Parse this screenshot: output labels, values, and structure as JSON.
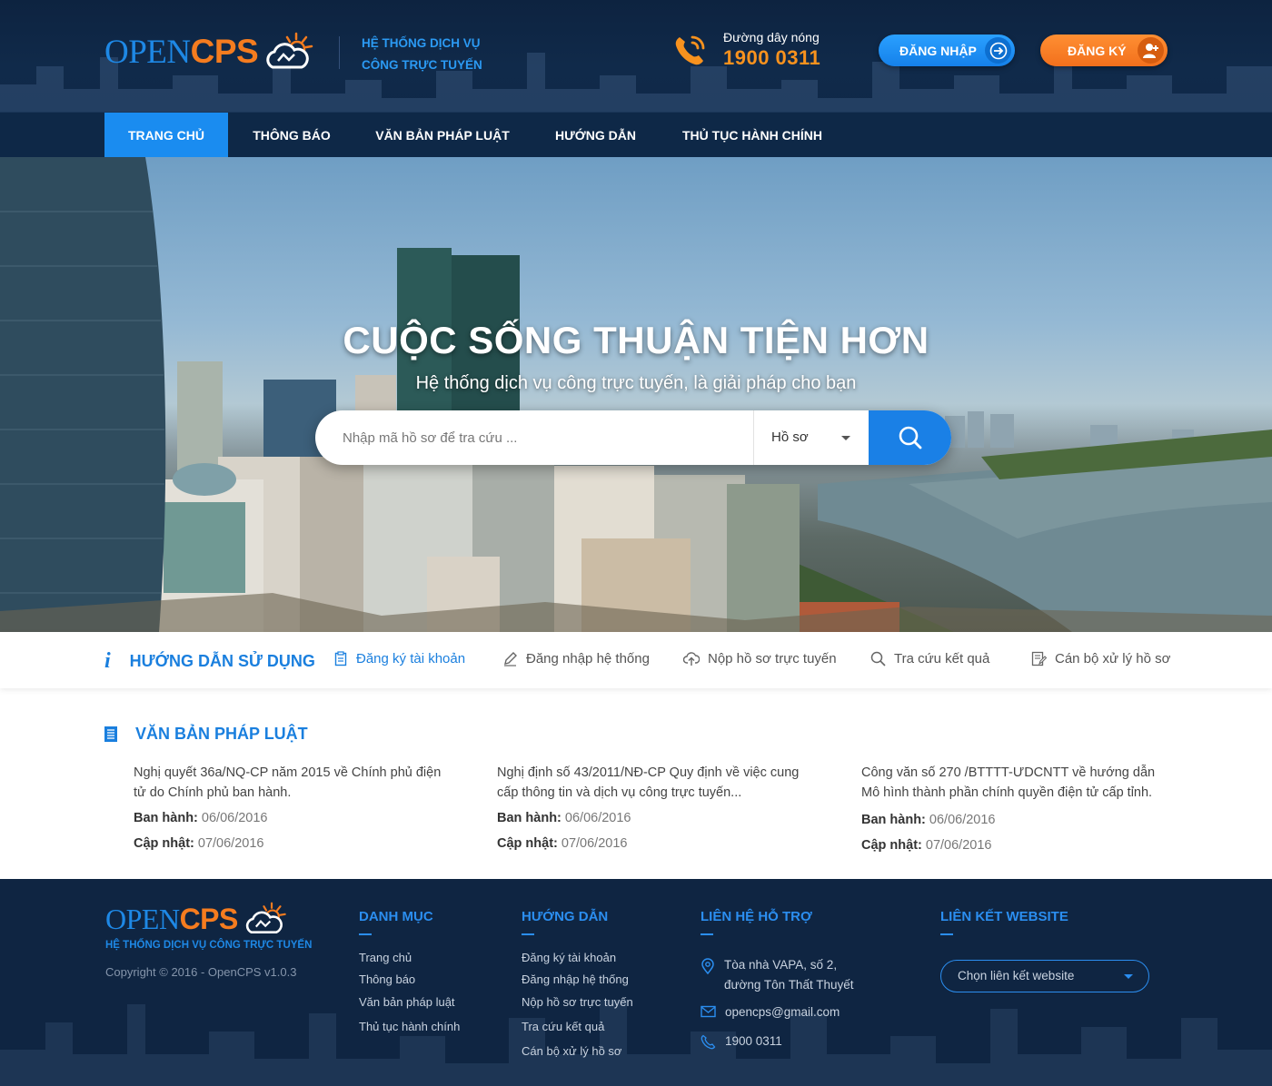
{
  "header": {
    "logo_open": "OPEN",
    "logo_cps": "CPS",
    "tagline_line1": "HỆ THỐNG DỊCH VỤ",
    "tagline_line2": "CÔNG TRỰC TUYẾN",
    "hotline_label": "Đường dây nóng",
    "hotline_number": "1900 0311",
    "login_label": "ĐĂNG NHẬP",
    "register_label": "ĐĂNG KÝ"
  },
  "nav": {
    "items": [
      {
        "label": "TRANG CHỦ",
        "active": true
      },
      {
        "label": "THÔNG BÁO"
      },
      {
        "label": "VĂN BẢN PHÁP LUẬT"
      },
      {
        "label": "HƯỚNG DẪN"
      },
      {
        "label": "THỦ TỤC HÀNH CHÍNH"
      }
    ]
  },
  "hero": {
    "title": "CUỘC SỐNG THUẬN TIỆN HƠN",
    "subtitle": "Hệ thống dịch vụ công trực tuyến, là giải pháp cho bạn",
    "search_placeholder": "Nhập mã hồ sơ để tra cứu ...",
    "search_value": "",
    "select_value": "Hồ sơ"
  },
  "guide": {
    "title": "HƯỚNG DẪN SỬ DỤNG",
    "items": [
      {
        "label": "Đăng ký tài khoản",
        "icon": "clipboard-icon"
      },
      {
        "label": "Đăng nhập hệ thống",
        "icon": "pencil-icon"
      },
      {
        "label": "Nộp hồ sơ trực tuyến",
        "icon": "cloud-upload-icon"
      },
      {
        "label": "Tra cứu kết quả",
        "icon": "search-icon"
      },
      {
        "label": "Cán bộ xử lý hồ sơ",
        "icon": "edit-document-icon"
      }
    ]
  },
  "legal": {
    "title": "VĂN BẢN PHÁP LUẬT",
    "issued_label": "Ban hành:",
    "updated_label": "Cập nhật:",
    "docs": [
      {
        "title": "Nghị quyết 36a/NQ-CP năm 2015 về Chính phủ điện tử do Chính phủ ban hành.",
        "issued": "06/06/2016",
        "updated": "07/06/2016"
      },
      {
        "title": "Nghị định số 43/2011/NĐ-CP Quy định về việc cung cấp thông tin và dịch vụ công trực tuyến...",
        "issued": "06/06/2016",
        "updated": "07/06/2016"
      },
      {
        "title": "Công văn số 270 /BTTTT-ƯDCNTT về hướng dẫn Mô hình thành phần chính quyền điện tử cấp tỉnh.",
        "issued": "06/06/2016",
        "updated": "07/06/2016"
      }
    ]
  },
  "footer": {
    "logo_open": "OPEN",
    "logo_cps": "CPS",
    "tagline": "HỆ THỐNG DỊCH VỤ CÔNG TRỰC TUYẾN",
    "copyright": "Copyright © 2016 - OpenCPS v1.0.3",
    "col_category": {
      "title": "DANH MỤC",
      "links": [
        "Trang chủ",
        "Thông báo",
        "Văn bản pháp luật",
        "Thủ tục hành chính"
      ]
    },
    "col_guide": {
      "title": "HƯỚNG DẪN",
      "links": [
        "Đăng ký tài khoản",
        "Đăng nhập hệ thống",
        "Nộp hồ sơ trực tuyến",
        "Tra cứu kết quả",
        "Cán bộ xử lý hồ sơ"
      ]
    },
    "col_contact": {
      "title": "LIÊN HỆ HỖ TRỢ",
      "address_line1": "Tòa nhà VAPA, số 2,",
      "address_line2": "đường Tôn Thất Thuyết",
      "email": "opencps@gmail.com",
      "phone": "1900 0311"
    },
    "col_links": {
      "title": "LIÊN KẾT WEBSITE",
      "select_value": "Chọn liên kết website"
    }
  },
  "colors": {
    "primary_blue": "#1a80e6",
    "accent_orange": "#f57c1f",
    "header_bg": "#0d2340",
    "footer_bg": "#0f2542"
  }
}
